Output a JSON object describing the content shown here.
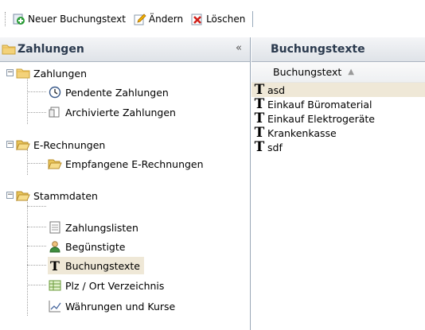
{
  "toolbar": {
    "new_label": "Neuer Buchungstext",
    "edit_label": "Ändern",
    "delete_label": "Löschen"
  },
  "left_panel": {
    "title": "Zahlungen",
    "collapse_glyph": "«",
    "tree": {
      "zahlungen": "Zahlungen",
      "pendente": "Pendente Zahlungen",
      "archivierte": "Archivierte Zahlungen",
      "erechnungen": "E-Rechnungen",
      "empfangene": "Empfangene E-Rechnungen",
      "stammdaten": "Stammdaten",
      "zahlungslisten": "Zahlungslisten",
      "beguenstigte": "Begünstigte",
      "buchungstexte": "Buchungstexte",
      "plz": "Plz / Ort Verzeichnis",
      "waehrungen": "Währungen und Kurse"
    }
  },
  "right_panel": {
    "title": "Buchungstexte",
    "column_header": "Buchungstext",
    "sort": "ascending",
    "rows": [
      "asd",
      "Einkauf Büromaterial",
      "Einkauf Elektrogeräte",
      "Krankenkasse",
      "sdf"
    ],
    "selected_row": "asd"
  },
  "colors": {
    "selection": "#efe8d7",
    "header_text": "#2b3a4e"
  }
}
